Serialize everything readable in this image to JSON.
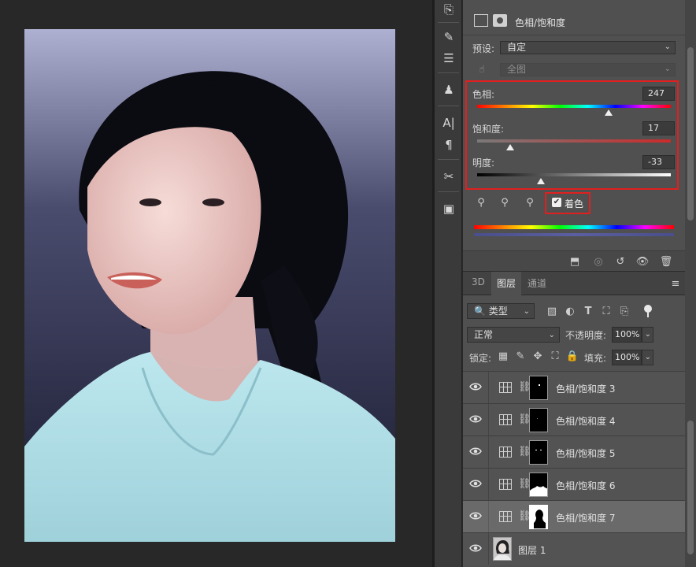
{
  "properties": {
    "adjustment_title": "色相/饱和度",
    "preset_label": "预设:",
    "preset_value": "自定",
    "range_value": "全图",
    "hue": {
      "label": "色相:",
      "value": "247",
      "slider_fraction": 0.68
    },
    "saturation": {
      "label": "饱和度:",
      "value": "17",
      "slider_fraction": 0.17
    },
    "lightness": {
      "label": "明度:",
      "value": "-33",
      "slider_fraction": 0.33
    },
    "colorize": {
      "label": "着色",
      "checked": true
    }
  },
  "layers_panel": {
    "tabs": [
      "3D",
      "图层",
      "通道"
    ],
    "active_tab": "图层",
    "filter_label": "类型",
    "blend_mode": "正常",
    "opacity_label": "不透明度:",
    "opacity_value": "100%",
    "lock_label": "锁定:",
    "fill_label": "填充:",
    "fill_value": "100%",
    "layers": [
      {
        "name": "色相/饱和度 3",
        "type": "adjustment",
        "selected": false
      },
      {
        "name": "色相/饱和度 4",
        "type": "adjustment",
        "selected": false
      },
      {
        "name": "色相/饱和度 5",
        "type": "adjustment",
        "selected": false
      },
      {
        "name": "色相/饱和度 6",
        "type": "adjustment",
        "selected": false
      },
      {
        "name": "色相/饱和度 7",
        "type": "adjustment",
        "selected": true
      },
      {
        "name": "图层 1",
        "type": "pixel",
        "selected": false
      }
    ]
  },
  "colors": {
    "panel_bg": "#505050",
    "highlight_border": "#e02020",
    "photo_background": "#23253d",
    "shirt": "#a8dbe5"
  }
}
